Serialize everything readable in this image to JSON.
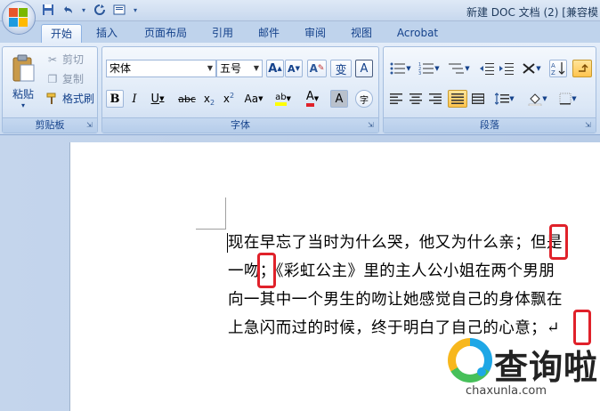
{
  "window": {
    "title": "新建 DOC 文档 (2) [兼容模"
  },
  "quick_access": {
    "save_icon": "save-icon",
    "undo_icon": "undo-icon",
    "redo_icon": "redo-icon",
    "print_icon": "print-icon",
    "customize_icon": "chevron-down-icon"
  },
  "tabs": [
    {
      "label": "开始",
      "active": true
    },
    {
      "label": "插入",
      "active": false
    },
    {
      "label": "页面布局",
      "active": false
    },
    {
      "label": "引用",
      "active": false
    },
    {
      "label": "邮件",
      "active": false
    },
    {
      "label": "审阅",
      "active": false
    },
    {
      "label": "视图",
      "active": false
    },
    {
      "label": "Acrobat",
      "active": false
    }
  ],
  "clipboard": {
    "paste_label": "粘贴",
    "cut_label": "剪切",
    "copy_label": "复制",
    "format_painter_label": "格式刷",
    "group_label": "剪贴板"
  },
  "font": {
    "font_name": "宋体",
    "font_size": "五号",
    "grow_label": "A",
    "shrink_label": "A",
    "clear_label": "A",
    "phonetic_label": "变",
    "border_label": "A",
    "bold_label": "B",
    "italic_label": "I",
    "underline_label": "U",
    "strike_label": "abc",
    "subscript_label": "x",
    "superscript_label": "x",
    "case_label": "Aa",
    "highlight_label": "ab",
    "color_label": "A",
    "shade_label": "A",
    "enclose_label": "字",
    "group_label": "字体"
  },
  "paragraph": {
    "group_label": "段落"
  },
  "document": {
    "lines": [
      "现在早忘了当时为什么哭，他又为什么亲；但是",
      "一吻；《彩虹公主》里的主人公小姐在两个男朋",
      "向一其中一个男生的吻让她感觉自己的身体飘在",
      "上急闪而过的时候，终于明白了自己的心意；↵"
    ]
  },
  "watermark": {
    "title": "查询啦",
    "domain": "chaxunla.com"
  },
  "colors": {
    "highlight_box": "#e0212a",
    "ribbon_text": "#15428b"
  }
}
